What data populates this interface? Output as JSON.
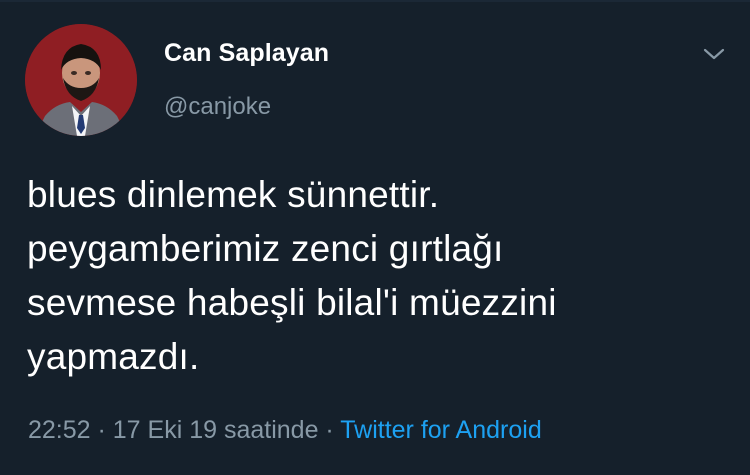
{
  "tweet": {
    "author_name": "Can Saplayan",
    "author_handle": "@canjoke",
    "text_lines": [
      "blues dinlemek sünnettir.",
      "peygamberimiz zenci gırtlağı",
      "sevmese habeşli bilal'i müezzini",
      "yapmazdı."
    ],
    "time": "22:52",
    "date_suffix": " · 17 Eki 19 saatinde · ",
    "source": "Twitter for Android"
  },
  "icons": {
    "avatar": "profile-photo-icon",
    "menu": "chevron-down-icon"
  },
  "colors": {
    "background": "#15202b",
    "text": "#ffffff",
    "muted": "#8899a6",
    "link": "#1da1f2"
  }
}
